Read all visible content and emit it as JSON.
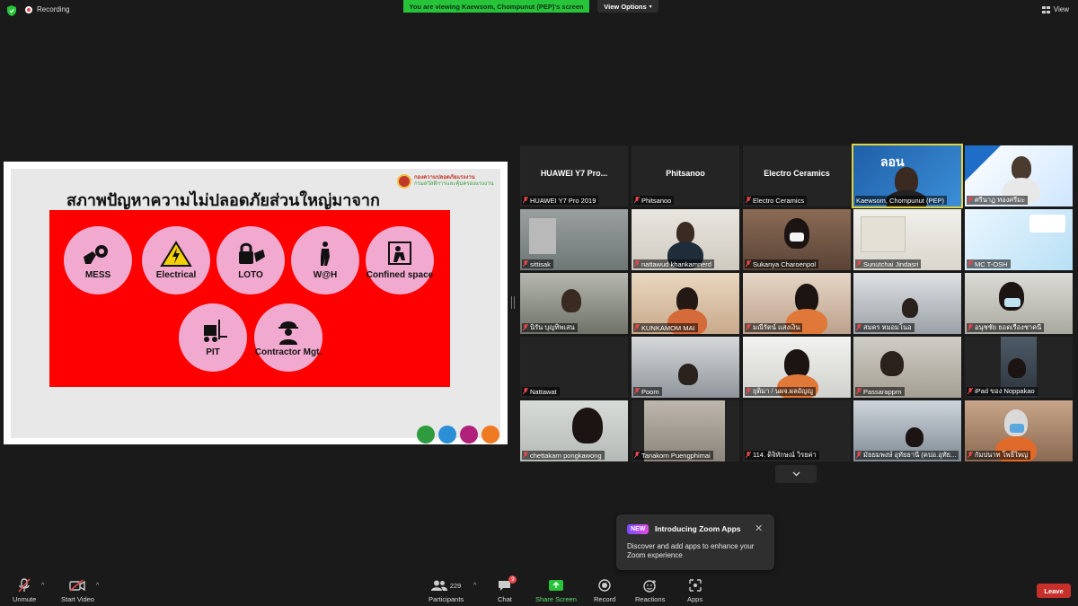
{
  "topbar": {
    "recording_label": "Recording",
    "viewing_banner": "You are viewing Kaewsom, Chompunut (PEP)'s screen",
    "view_options_label": "View Options",
    "view_label": "View"
  },
  "colors": {
    "accent_green": "#27c43a",
    "leave_red": "#c8302c",
    "active_speaker": "#e2d342",
    "slide_panel_red": "#ff0000",
    "hazard_pink": "#f2a9cf"
  },
  "slide": {
    "title": "สภาพปัญหาความไม่ปลอดภัยส่วนใหญ่มาจาก",
    "logo_line1": "กองความปลอดภัยแรงงาน",
    "logo_line2": "กรมสวัสดิการและคุ้มครองแรงงาน",
    "hazards": [
      {
        "label": "MESS",
        "icon": "gear-hand-icon"
      },
      {
        "label": "Electrical",
        "icon": "electric-warning-icon"
      },
      {
        "label": "LOTO",
        "icon": "lock-tag-icon"
      },
      {
        "label": "W@H",
        "icon": "harness-worker-icon"
      },
      {
        "label": "Confined space",
        "icon": "confined-space-icon"
      },
      {
        "label": "PIT",
        "icon": "forklift-icon"
      },
      {
        "label": "Contractor Mgt.",
        "icon": "hardhat-worker-icon"
      }
    ]
  },
  "participants": [
    {
      "name": "HUAWEI Y7 Pro 2019",
      "display": "HUAWEI Y7 Pro...",
      "video": false
    },
    {
      "name": "Phitsanoo",
      "display": "Phitsanoo",
      "video": false
    },
    {
      "name": "Electro Ceramics",
      "display": "Electro Ceramics",
      "video": false
    },
    {
      "name": "Kaewsom, Chompunut (PEP)",
      "video": true,
      "active": true
    },
    {
      "name": "ศรีนาฏ ทองศรีมะ",
      "video": true
    },
    {
      "name": "sittisak",
      "video": true
    },
    {
      "name": "nattawud khankamnerd",
      "video": true
    },
    {
      "name": "Sukanya Charoenpol",
      "video": true
    },
    {
      "name": "Sunutchai Jindasri",
      "video": true
    },
    {
      "name": "MC T-OSH",
      "video": true
    },
    {
      "name": "นิรัน บุญทิพเสน",
      "video": true
    },
    {
      "name": "KUNKAMOM MAI",
      "video": true
    },
    {
      "name": "มณีรัตน์ แสงเงิน",
      "video": true
    },
    {
      "name": "สมคร หมอมโนอ",
      "video": true
    },
    {
      "name": "อนุชชัย ยอดเรืองชาคนี",
      "video": true
    },
    {
      "name": "Nattawat",
      "video": true
    },
    {
      "name": "Poom",
      "video": true
    },
    {
      "name": "ยุติมา / นผจ.ผลอัญญู",
      "video": true
    },
    {
      "name": "Passarapprn",
      "video": true
    },
    {
      "name": "iPad ของ Noppakao",
      "video": true
    },
    {
      "name": "chettakarn pongkawong",
      "video": true
    },
    {
      "name": "Tanakorn Puengphimai",
      "video": true
    },
    {
      "name": "114. ดิจิทักษณ์ วิรยค่า",
      "video": false
    },
    {
      "name": "มัธยมพงษ์ อุทัยธานี (คปอ.อุทัย...",
      "video": true
    },
    {
      "name": "กัมปนาท โพธิ์ใหญ่",
      "video": true
    }
  ],
  "popup": {
    "badge": "NEW",
    "title": "Introducing Zoom Apps",
    "body": "Discover and add apps to enhance your Zoom experience"
  },
  "toolbar": {
    "unmute": "Unmute",
    "start_video": "Start Video",
    "participants": "Participants",
    "participants_count": "229",
    "chat": "Chat",
    "chat_badge": "9",
    "share_screen": "Share Screen",
    "record": "Record",
    "reactions": "Reactions",
    "apps": "Apps",
    "leave": "Leave"
  }
}
